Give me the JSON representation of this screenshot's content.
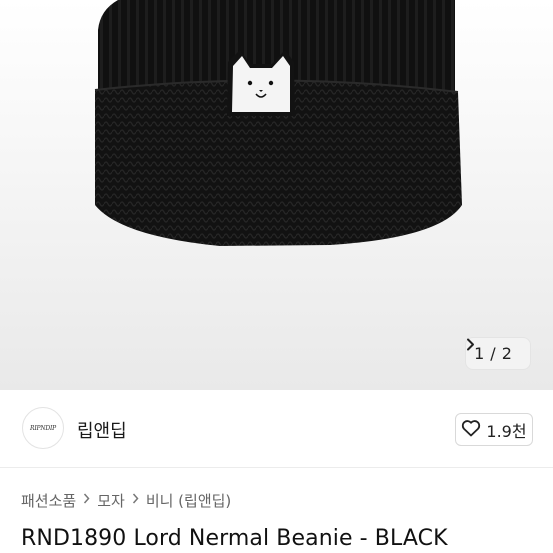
{
  "gallery": {
    "image_subject": "black knit beanie with cat patch",
    "current_index": "1",
    "separator": "/",
    "total": "2",
    "next_icon": "chevron-right-icon"
  },
  "shop": {
    "logo_text": "RIPNDIP",
    "name": "립앤딥",
    "like_icon": "heart-outline-icon",
    "like_count": "1.9천"
  },
  "breadcrumb": {
    "items": [
      "패션소품",
      "모자",
      "비니 (립앤딥)"
    ],
    "separator_icon": "chevron-right-icon"
  },
  "product": {
    "title": "RND1890 Lord Nermal Beanie - BLACK"
  },
  "colors": {
    "beanie": "#111111",
    "background": "#f2f2f2",
    "text": "#222222"
  }
}
